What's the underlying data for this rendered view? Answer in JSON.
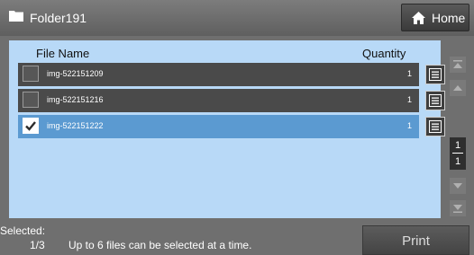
{
  "header": {
    "folder_icon": "folder-icon",
    "folder_name": "Folder191",
    "home_icon": "home-icon",
    "home_label": "Home"
  },
  "table": {
    "col_filename": "File Name",
    "col_quantity": "Quantity",
    "rows": [
      {
        "name": "img-522151209",
        "quantity": "1",
        "checked": false
      },
      {
        "name": "img-522151216",
        "quantity": "1",
        "checked": false
      },
      {
        "name": "img-522151222",
        "quantity": "1",
        "checked": true
      }
    ]
  },
  "pagination": {
    "current": "1",
    "total": "1"
  },
  "footer": {
    "selected_label": "Selected:",
    "selected_count": "1/3",
    "hint": "Up to 6 files can be selected at a time.",
    "print_label": "Print"
  },
  "colors": {
    "panel": "#b8d9f7",
    "row": "#4a4a4a",
    "row_selected": "#5b9ad1",
    "background": "#6f6f6f"
  }
}
